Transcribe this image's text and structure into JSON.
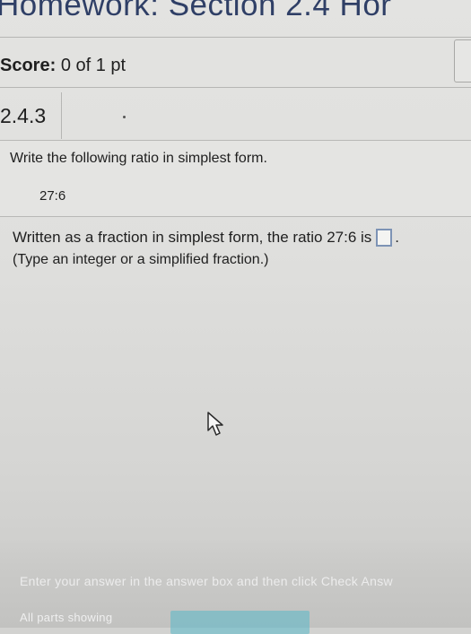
{
  "header": {
    "title": "Homework: Section 2.4 Hor"
  },
  "score": {
    "label": "Score:",
    "value": "0 of 1 pt"
  },
  "question": {
    "number": "2.4.3",
    "instruction": "Write the following ratio in simplest form.",
    "ratio": "27:6",
    "prompt": "Written as a fraction in simplest form, the ratio 27:6 is",
    "answer_value": "",
    "answer_suffix": ".",
    "hint": "(Type an integer or a simplified fraction.)"
  },
  "footer": {
    "hint": "Enter your answer in the answer box and then click Check Answ",
    "parts_status": "All parts showing",
    "check_button_label": ""
  },
  "colors": {
    "title": "#2f3f66",
    "answer_box_border": "#7d93b5",
    "check_button": "#58b8c8"
  }
}
